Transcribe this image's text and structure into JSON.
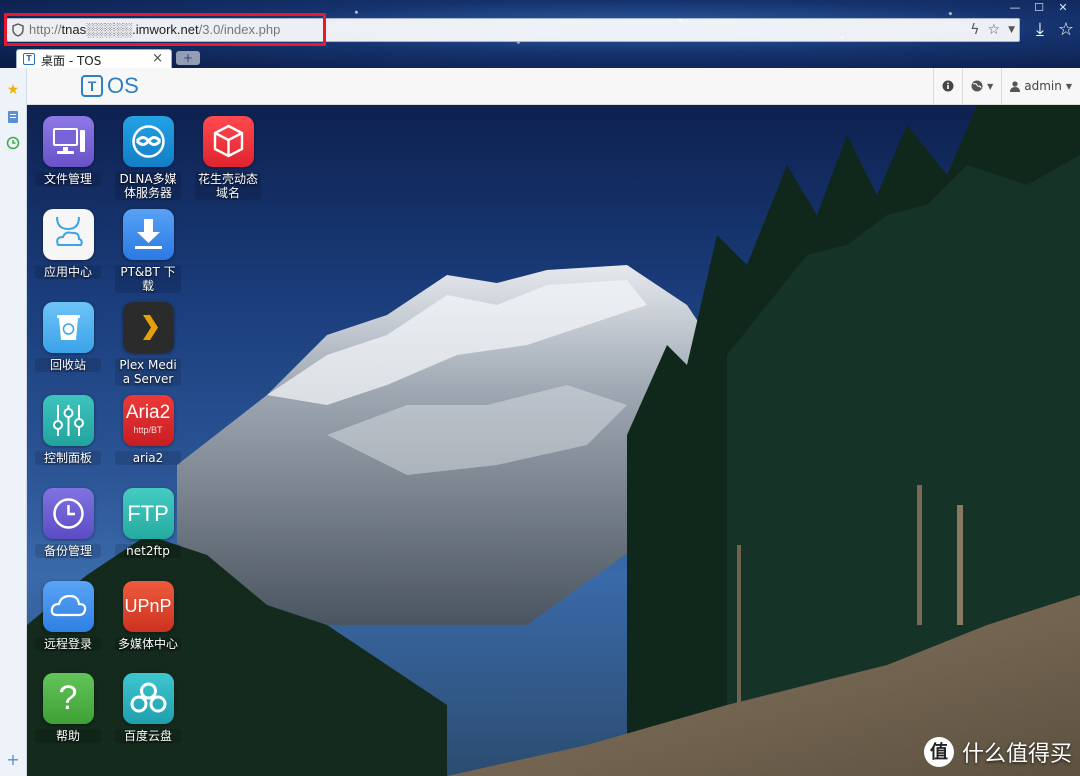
{
  "browser": {
    "url_prefix": "http://",
    "url_host": "tnas░░░░░.imwork.net",
    "url_path": "/3.0/index.php",
    "window_controls": [
      "—",
      "☐",
      "✕"
    ],
    "tab_title": "桌面 - TOS",
    "tab_close": "×",
    "new_tab": "+"
  },
  "tos": {
    "logo_t": "T",
    "logo_os": "OS",
    "user": "admin"
  },
  "apps": [
    {
      "label": "文件管理",
      "icon": "monitor-icon",
      "bg": "#7a63d8"
    },
    {
      "label": "DLNA多媒体服务器",
      "icon": "dlna-icon",
      "bg": "#1a8fd6"
    },
    {
      "label": "花生壳动态域名",
      "icon": "cube-icon",
      "bg": "#f0353e"
    },
    {
      "label": "应用中心",
      "icon": "cloud-bag-icon",
      "bg": "#f4f4f4"
    },
    {
      "label": "PT&BT 下载",
      "icon": "download-icon",
      "bg": "#3d8df0"
    },
    {
      "label": "回收站",
      "icon": "recycle-icon",
      "bg": "#4fb3f0"
    },
    {
      "label": "Plex Media Server",
      "icon": "plex-icon",
      "bg": "#2b2b2b"
    },
    {
      "label": "控制面板",
      "icon": "sliders-icon",
      "bg": "#2cb6b0"
    },
    {
      "label": "aria2",
      "icon": "aria2-icon",
      "bg": "#e0262c",
      "title": "Aria2",
      "sub": "http/BT"
    },
    {
      "label": "备份管理",
      "icon": "clock-icon",
      "bg": "#6a5ad0"
    },
    {
      "label": "net2ftp",
      "icon": "ftp-icon",
      "bg": "#33c0b6",
      "title": "FTP"
    },
    {
      "label": "远程登录",
      "icon": "cloud-icon",
      "bg": "#3f92ee"
    },
    {
      "label": "多媒体中心",
      "icon": "upnp-icon",
      "bg": "#e2452f",
      "title": "UPnP"
    },
    {
      "label": "帮助",
      "icon": "help-icon",
      "bg": "#4db548",
      "title": "?"
    },
    {
      "label": "百度云盘",
      "icon": "baidu-cloud-icon",
      "bg": "#2fb6c2"
    }
  ],
  "watermark": {
    "logo": "值",
    "text": "什么值得买"
  }
}
